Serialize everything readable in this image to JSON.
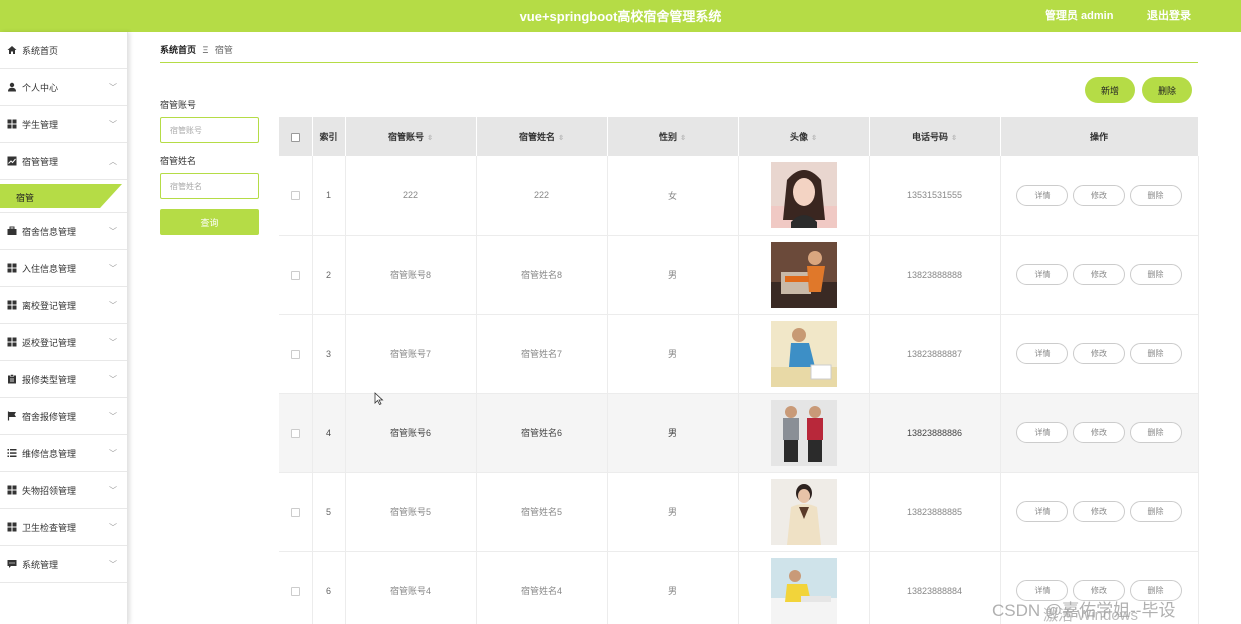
{
  "header": {
    "title": "vue+springboot高校宿舍管理系统",
    "user": "管理员 admin",
    "logout": "退出登录"
  },
  "sidebar": {
    "items": [
      {
        "label": "系统首页",
        "icon": "home-icon",
        "glyph": "⌂",
        "chev": ""
      },
      {
        "label": "个人中心",
        "icon": "user-icon",
        "glyph": "●",
        "chev": "⌄"
      },
      {
        "label": "学生管理",
        "icon": "grid-icon",
        "glyph": "▦",
        "chev": "⌄"
      },
      {
        "label": "宿管管理",
        "icon": "chart-icon",
        "glyph": "▨",
        "chev": "⌃"
      },
      {
        "label": "宿舍信息管理",
        "icon": "briefcase-icon",
        "glyph": "▬",
        "chev": "⌄"
      },
      {
        "label": "入住信息管理",
        "icon": "grid-icon",
        "glyph": "▦",
        "chev": "⌄"
      },
      {
        "label": "离校登记管理",
        "icon": "grid-icon",
        "glyph": "▦",
        "chev": "⌄"
      },
      {
        "label": "返校登记管理",
        "icon": "grid-icon",
        "glyph": "▦",
        "chev": "⌄"
      },
      {
        "label": "报修类型管理",
        "icon": "clipboard-icon",
        "glyph": "▣",
        "chev": "⌄"
      },
      {
        "label": "宿舍报修管理",
        "icon": "flag-icon",
        "glyph": "⚑",
        "chev": "⌄"
      },
      {
        "label": "维修信息管理",
        "icon": "list-icon",
        "glyph": "☰",
        "chev": "⌄"
      },
      {
        "label": "失物招领管理",
        "icon": "grid-icon",
        "glyph": "▦",
        "chev": "⌄"
      },
      {
        "label": "卫生检查管理",
        "icon": "grid-icon",
        "glyph": "▦",
        "chev": "⌄"
      },
      {
        "label": "系统管理",
        "icon": "chat-icon",
        "glyph": "▩",
        "chev": "⌄"
      }
    ],
    "submenu_active": "宿管"
  },
  "breadcrumb": {
    "home": "系统首页",
    "sep": "Ξ",
    "current": "宿管"
  },
  "search": {
    "account_label": "宿管账号",
    "account_placeholder": "宿管账号",
    "name_label": "宿管姓名",
    "name_placeholder": "宿管姓名",
    "button": "查询"
  },
  "actions": {
    "add": "新增",
    "delete": "删除"
  },
  "table": {
    "headers": {
      "index": "索引",
      "account": "宿管账号",
      "name": "宿管姓名",
      "gender": "性别",
      "avatar": "头像",
      "phone": "电话号码",
      "ops": "操作"
    },
    "row_buttons": {
      "detail": "详情",
      "edit": "修改",
      "delete": "删除"
    },
    "rows": [
      {
        "index": "1",
        "account": "222",
        "name": "222",
        "gender": "女",
        "phone": "13531531555"
      },
      {
        "index": "2",
        "account": "宿管账号8",
        "name": "宿管姓名8",
        "gender": "男",
        "phone": "13823888888"
      },
      {
        "index": "3",
        "account": "宿管账号7",
        "name": "宿管姓名7",
        "gender": "男",
        "phone": "13823888887"
      },
      {
        "index": "4",
        "account": "宿管账号6",
        "name": "宿管姓名6",
        "gender": "男",
        "phone": "13823888886"
      },
      {
        "index": "5",
        "account": "宿管账号5",
        "name": "宿管姓名5",
        "gender": "男",
        "phone": "13823888885"
      },
      {
        "index": "6",
        "account": "宿管账号4",
        "name": "宿管姓名4",
        "gender": "男",
        "phone": "13823888884"
      }
    ]
  },
  "watermark": {
    "csdn": "CSDN @嘉佑学姐--毕设",
    "windows": "激活 Windows"
  }
}
